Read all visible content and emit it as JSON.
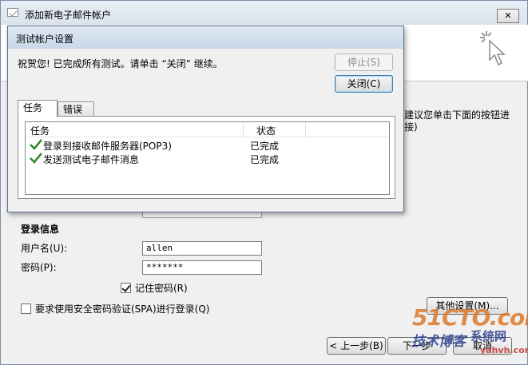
{
  "outer_window": {
    "title": "添加新电子邮件帐户",
    "close_symbol": "✕",
    "hint_text": "建议您单击下面的按钮进\n接)",
    "login_section": {
      "heading": "登录信息",
      "username_label": "用户名(U):",
      "username_value": "allen",
      "password_label": "密码(P):",
      "password_value": "*******",
      "remember_password_label": "记住密码(R)",
      "remember_password_checked": true,
      "spa_label": "要求使用安全密码验证(SPA)进行登录(Q)",
      "spa_checked": false
    },
    "buttons": {
      "more_settings": "其他设置(M)...",
      "back": "< 上一步(B)",
      "next": "下一步",
      "cancel": "取消"
    },
    "watermark": {
      "line1": "51CTO.com",
      "line2": "技术博客",
      "line3": "系统网",
      "line4": "yahvh.com"
    }
  },
  "dialog": {
    "title": "测试帐户设置",
    "message": "祝贺您! 已完成所有测试。请单击 “关闭” 继续。",
    "stop_button": "停止(S)",
    "close_button": "关闭(C)",
    "tabs": [
      {
        "label": "任务",
        "active": true
      },
      {
        "label": "错误",
        "active": false
      }
    ],
    "columns": {
      "task": "任务",
      "status": "状态"
    },
    "rows": [
      {
        "task": "登录到接收邮件服务器(POP3)",
        "status": "已完成"
      },
      {
        "task": "发送测试电子邮件消息",
        "status": "已完成"
      }
    ]
  },
  "colors": {
    "check_mark": "#2e8b2e",
    "window_bg": "#f0f0f0",
    "title_bar": "#dbe3ee"
  }
}
